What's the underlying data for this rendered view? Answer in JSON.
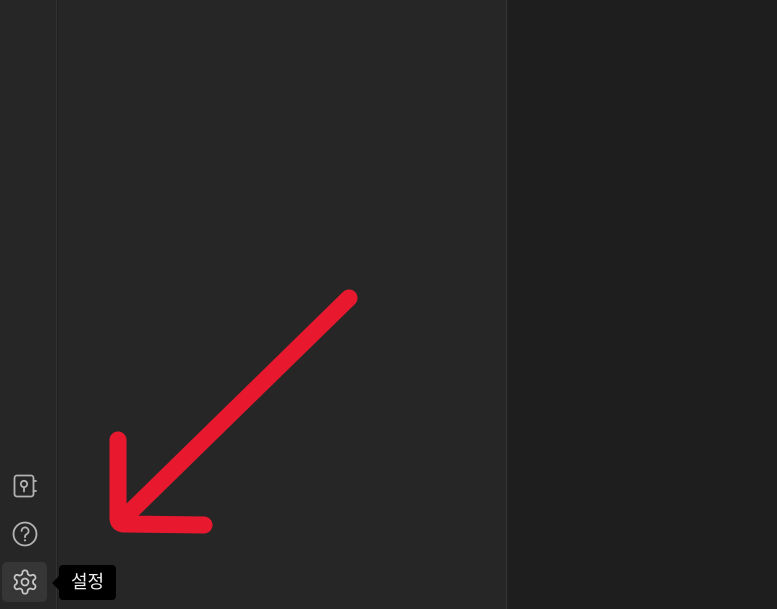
{
  "ribbon": {
    "buttons": [
      {
        "id": "vault",
        "icon": "vault-icon"
      },
      {
        "id": "help",
        "icon": "help-circle-icon"
      },
      {
        "id": "settings",
        "icon": "gear-icon"
      }
    ]
  },
  "tooltip": {
    "text": "설정"
  },
  "annotation": {
    "type": "arrow",
    "color": "#e8192f"
  }
}
